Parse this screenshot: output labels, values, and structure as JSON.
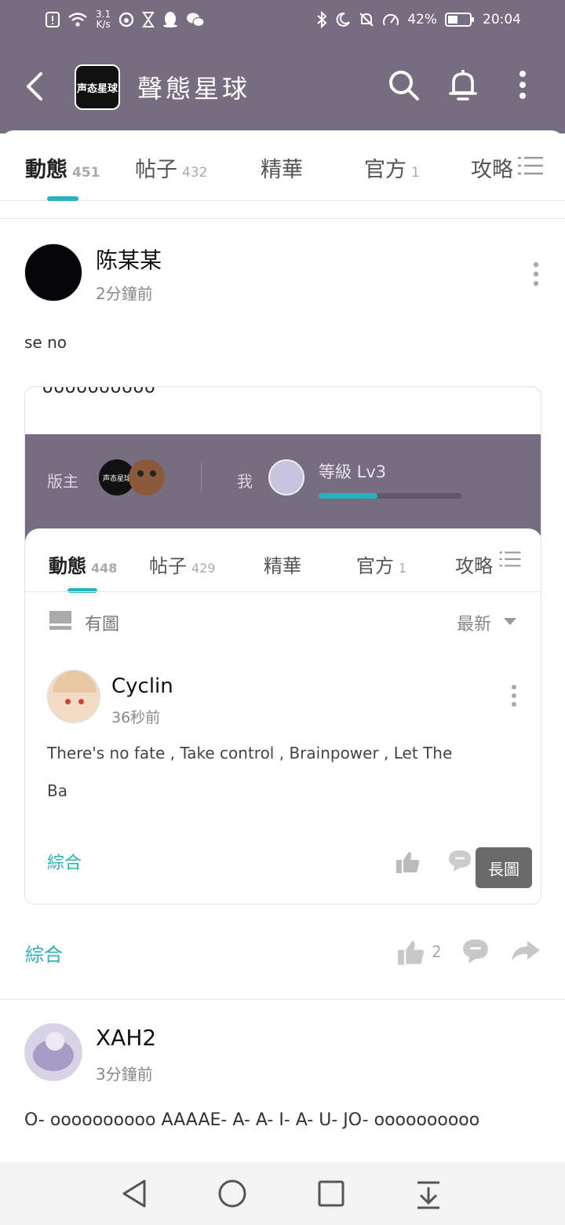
{
  "status_bar": {
    "net_speed": "3.1",
    "net_unit": "K/s",
    "battery": "42%",
    "time": "20:04"
  },
  "app_bar": {
    "title": "聲態星球",
    "logo_text": "声态星球"
  },
  "tabs": [
    {
      "label": "動態",
      "count": "451"
    },
    {
      "label": "帖子",
      "count": "432"
    },
    {
      "label": "精華",
      "count": ""
    },
    {
      "label": "官方",
      "count": "1"
    },
    {
      "label": "攻略",
      "count": ""
    }
  ],
  "post1": {
    "user": "陈某某",
    "time": "2分鐘前",
    "text": "se no",
    "embed": {
      "clipped_text": "oooooooooo",
      "moderator_label": "版主",
      "me_label": "我",
      "level": "等級 Lv3",
      "level_progress": 0.41,
      "tabs": [
        {
          "label": "動態",
          "count": "448"
        },
        {
          "label": "帖子",
          "count": "429"
        },
        {
          "label": "精華",
          "count": ""
        },
        {
          "label": "官方",
          "count": "1"
        },
        {
          "label": "攻略",
          "count": ""
        }
      ],
      "filter_label": "有圖",
      "sort_label": "最新",
      "inner_post": {
        "user": "Cyclin",
        "time": "36秒前",
        "text_line1": "There's no fate , Take control , Brainpower , Let The",
        "text_line2": "Ba",
        "category": "綜合"
      },
      "long_image_badge": "長圖"
    },
    "category": "綜合",
    "like_count": "2"
  },
  "post2": {
    "user": "XAH2",
    "time": "3分鐘前",
    "text": "O- oooooooooo AAAAE- A- A- I- A- U- JO- oooooooooo"
  },
  "colors": {
    "header": "#766d80",
    "accent": "#27b3bd"
  }
}
